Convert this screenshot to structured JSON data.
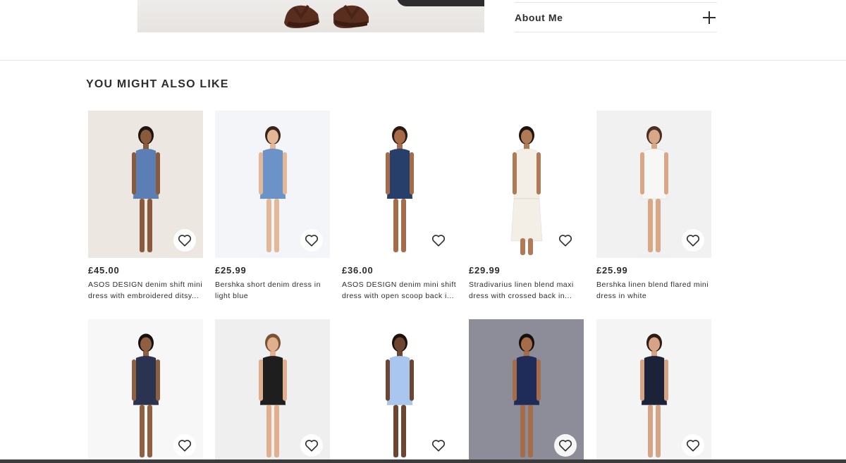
{
  "accordion": {
    "label": "About Me",
    "icon": "plus-icon"
  },
  "section": {
    "title": "YOU MIGHT ALSO LIKE"
  },
  "products_row1": [
    {
      "price": "£45.00",
      "name": "ASOS DESIGN denim shift mini dress with embroidered ditsy...",
      "dress": "#5b7fb5",
      "bg": "#ece7e1",
      "skin": "#8a5a3c",
      "hair": "#1b1410"
    },
    {
      "price": "£25.99",
      "name": "Bershka short denim dress in light blue",
      "dress": "#6b93c7",
      "bg": "#f3f5f8",
      "skin": "#e2b898",
      "hair": "#3a2518"
    },
    {
      "price": "£36.00",
      "name": "ASOS DESIGN denim mini shift dress with open scoop back i...",
      "dress": "#26406b",
      "bg": "#ffffff",
      "skin": "#a66b48",
      "hair": "#2a1a10"
    },
    {
      "price": "£29.99",
      "name": "Stradivarius linen blend maxi dress with crossed back in...",
      "dress": "#f3eee6",
      "bg": "#ffffff",
      "skin": "#b07a56",
      "hair": "#1e140e"
    },
    {
      "price": "£25.99",
      "name": "Bershka linen blend flared mini dress in white",
      "dress": "#f7f7f5",
      "bg": "#f1f1f1",
      "skin": "#d9a788",
      "hair": "#4a3020"
    }
  ],
  "products_row2": [
    {
      "dress": "#2a3350",
      "bg": "#f7f7f7",
      "skin": "#8f5f42",
      "hair": "#161010"
    },
    {
      "dress": "#1e1e1e",
      "bg": "#efefef",
      "skin": "#e0b08e",
      "hair": "#7a5234"
    },
    {
      "dress": "#a9c6ee",
      "bg": "#ffffff",
      "skin": "#6e4530",
      "hair": "#1c120c"
    },
    {
      "dress": "#1f2c5a",
      "bg": "#8d8d99",
      "skin": "#a46c48",
      "hair": "#15100d"
    },
    {
      "dress": "#1c2238",
      "bg": "#f4f4f4",
      "skin": "#d5a385",
      "hair": "#2c1c12"
    }
  ],
  "heart_icon": "heart-outline-icon"
}
